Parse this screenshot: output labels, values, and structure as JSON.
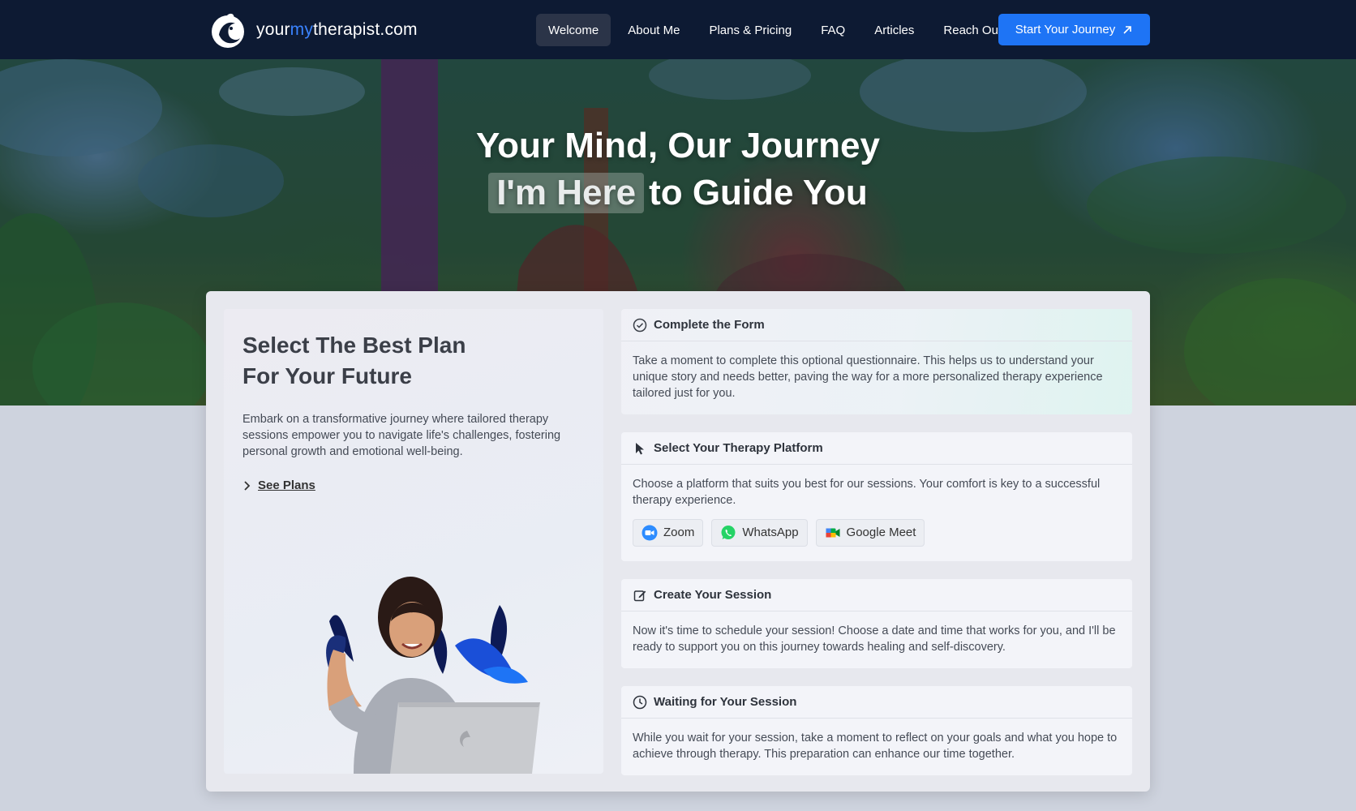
{
  "header": {
    "logo": {
      "text_prefix": "your",
      "text_accent": "my",
      "text_suffix": "therapist.com"
    },
    "nav": [
      {
        "label": "Welcome",
        "active": true
      },
      {
        "label": "About Me",
        "active": false
      },
      {
        "label": "Plans & Pricing",
        "active": false
      },
      {
        "label": "FAQ",
        "active": false
      },
      {
        "label": "Articles",
        "active": false
      },
      {
        "label": "Reach Out",
        "active": false
      }
    ],
    "cta_label": "Start Your Journey"
  },
  "hero": {
    "line1": "Your Mind, Our Journey",
    "highlight": "I'm Here",
    "line2_rest": "to Guide You"
  },
  "plans": {
    "title_line1": "Select The Best Plan",
    "title_line2": "For Your Future",
    "description": "Embark on a transformative journey where tailored therapy sessions empower you to navigate life's challenges, fostering personal growth and emotional well-being.",
    "see_plans": "See Plans"
  },
  "steps": [
    {
      "title": "Complete the Form",
      "icon": "check-circle-icon",
      "body": "Take a moment to complete this optional questionnaire. This helps us to understand your unique story and needs better, paving the way for a more personalized therapy experience tailored just for you."
    },
    {
      "title": "Select Your Therapy Platform",
      "icon": "cursor-icon",
      "body": "Choose a platform that suits you best for our sessions. Your comfort is key to a successful therapy experience.",
      "platforms": [
        "Zoom",
        "WhatsApp",
        "Google Meet"
      ]
    },
    {
      "title": "Create Your Session",
      "icon": "edit-icon",
      "body": "Now it's time to schedule your session! Choose a date and time that works for you, and I'll be ready to support you on this journey towards healing and self-discovery."
    },
    {
      "title": "Waiting for Your Session",
      "icon": "clock-icon",
      "body": "While you wait for your session, take a moment to reflect on your goals and what you hope to achieve through therapy. This preparation can enhance our time together."
    }
  ],
  "colors": {
    "navbar": "#0d1a33",
    "accent": "#1e74f5",
    "logo_accent": "#3a83ff"
  }
}
